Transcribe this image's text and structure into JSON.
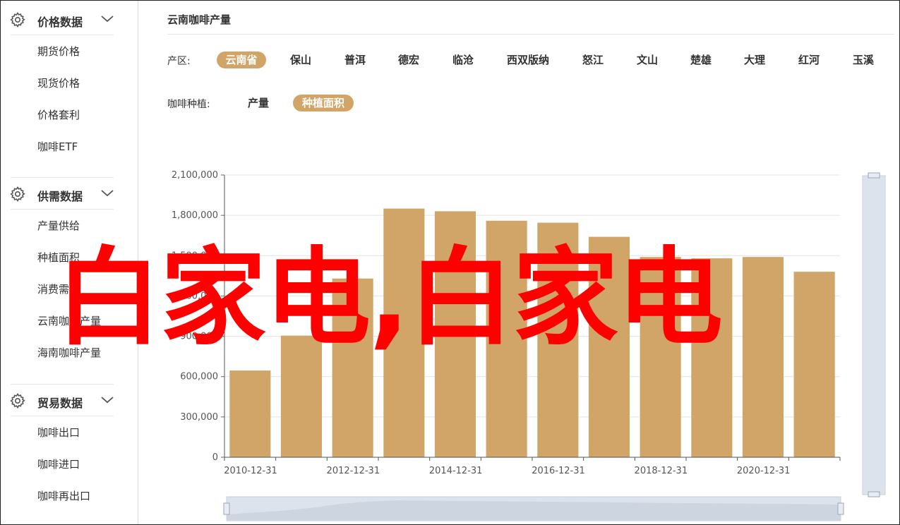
{
  "sidebar": {
    "groups": [
      {
        "title": "价格数据",
        "icon": "gear-icon",
        "items": [
          "期货价格",
          "现货价格",
          "价格套利",
          "咖啡ETF"
        ]
      },
      {
        "title": "供需数据",
        "icon": "gear-icon",
        "items": [
          "产量供给",
          "种植面积",
          "消费需求",
          "云南咖啡产量",
          "海南咖啡产量"
        ]
      },
      {
        "title": "贸易数据",
        "icon": "gear-icon",
        "items": [
          "咖啡出口",
          "咖啡进口",
          "咖啡再出口"
        ]
      }
    ]
  },
  "main": {
    "title": "云南咖啡产量",
    "region_label": "产区:",
    "regions": [
      "云南省",
      "保山",
      "普洱",
      "德宏",
      "临沧",
      "西双版纳",
      "怒江",
      "文山",
      "楚雄",
      "大理",
      "红河",
      "玉溪"
    ],
    "active_region": "云南省",
    "type_label": "咖啡种植:",
    "types": [
      "产量",
      "种植面积"
    ],
    "active_type": "种植面积"
  },
  "overlay_text": "白家电,白家电",
  "accent_color": "#d1a467",
  "chart_data": {
    "type": "bar",
    "x": [
      "2010-12-31",
      "2011-12-31",
      "2012-12-31",
      "2013-12-31",
      "2014-12-31",
      "2015-12-31",
      "2016-12-31",
      "2017-12-31",
      "2018-12-31",
      "2019-12-31",
      "2020-12-31",
      "2021-12-31"
    ],
    "values": [
      645000,
      905000,
      1330000,
      1850000,
      1830000,
      1760000,
      1745000,
      1640000,
      1490000,
      1480000,
      1490000,
      1380000
    ],
    "ylim": [
      0,
      2100000
    ],
    "yticks": [
      0,
      300000,
      600000,
      900000,
      1200000,
      1500000,
      1800000,
      2100000
    ],
    "ytick_labels": [
      "0",
      "300,000",
      "600,000",
      "900,000",
      "1,200,000",
      "1,500,000",
      "1,800,000",
      "2,100,000"
    ],
    "xtick_labels": [
      "2010-12-31",
      "2012-12-31",
      "2014-12-31",
      "2016-12-31",
      "2018-12-31",
      "2020-12-31"
    ],
    "grid": true,
    "bar_color": "#d1a467"
  }
}
